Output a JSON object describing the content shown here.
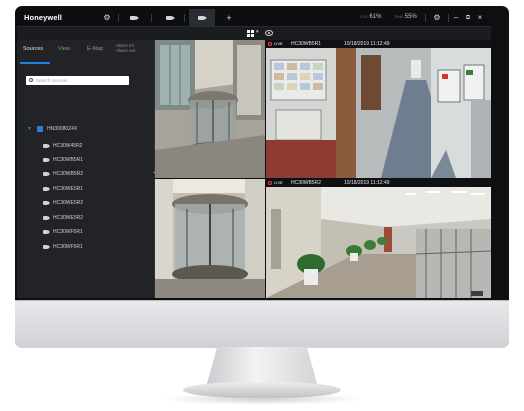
{
  "app": {
    "logo": "Honeywell"
  },
  "topbar": {
    "gear_glyph": "⚙",
    "add_glyph": "+",
    "cpu_label": "CPU",
    "cpu_value": "61%",
    "ram_label": "RAM",
    "ram_value": "55%",
    "settings_glyph": "⚙",
    "minimize_glyph": "–",
    "restore_glyph": "⧉",
    "close_glyph": "×"
  },
  "subbar": {
    "caret_glyph": "▾"
  },
  "sidebar": {
    "tabs": [
      "Sources",
      "View",
      "E-Map",
      "Alarm In/\nAlarm out"
    ],
    "search_placeholder": "Search sources",
    "root_label": "HN30080Z4X",
    "cameras": [
      "HC30W45R2",
      "HC30WB5R1",
      "HC30WB5R2",
      "HC30WE5R1",
      "HC30WE5R2",
      "HC30WE5R2",
      "HC30WF5R1",
      "HC30WF5R1"
    ],
    "collapse_glyph": "◂"
  },
  "tiles": [
    {
      "live": "",
      "name": "",
      "time": ""
    },
    {
      "live": "LIVE",
      "name": "HC30WB5R1",
      "time": "10/18/2019 11:12:49"
    },
    {
      "live": "",
      "name": "",
      "time": ""
    },
    {
      "live": "LIVE",
      "name": "HC30WB5R2",
      "time": "10/18/2019 11:12:49"
    }
  ]
}
